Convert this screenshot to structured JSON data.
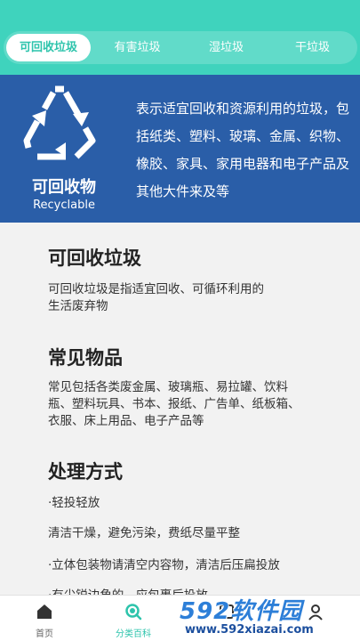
{
  "tabs": [
    {
      "label": "可回收垃圾",
      "active": true
    },
    {
      "label": "有害垃圾",
      "active": false
    },
    {
      "label": "湿垃圾",
      "active": false
    },
    {
      "label": "干垃圾",
      "active": false
    }
  ],
  "banner": {
    "title_cn": "可回收物",
    "title_en": "Recyclable",
    "description": "表示适宜回收和资源利用的垃圾，包括纸类、塑料、玻璃、金属、织物、橡胶、家具、家用电器和电子产品及其他大件来及等",
    "color": "#2a5ea8",
    "icon": "recycle-icon"
  },
  "sections": [
    {
      "title": "可回收垃圾",
      "text": "可回收垃圾是指适宜回收、可循环利用的生活废弃物"
    },
    {
      "title": "常见物品",
      "text": "常见包括各类废金属、玻璃瓶、易拉罐、饮料瓶、塑料玩具、书本、报纸、广告单、纸板箱、衣服、床上用品、电子产品等"
    },
    {
      "title": "处理方式",
      "items": [
        "·轻投轻放",
        "清洁干燥，避免污染，费纸尽量平整",
        "·立体包装物请清空内容物，清洁后压扁投放",
        "·有尖锐边角的，应包裹后投放"
      ]
    }
  ],
  "bottom_nav": [
    {
      "label": "首页",
      "icon": "home-icon",
      "active": false
    },
    {
      "label": "分类百科",
      "icon": "search-icon",
      "active": true
    },
    {
      "label": "",
      "icon": "scan-icon",
      "active": false
    },
    {
      "label": "",
      "icon": "user-icon",
      "active": false
    }
  ],
  "watermark": {
    "big": "592软件园",
    "small": "www.592xiazai.com"
  },
  "colors": {
    "accent": "#3fd3bd",
    "banner": "#2a5ea8",
    "active_text": "#2ec4ac"
  }
}
